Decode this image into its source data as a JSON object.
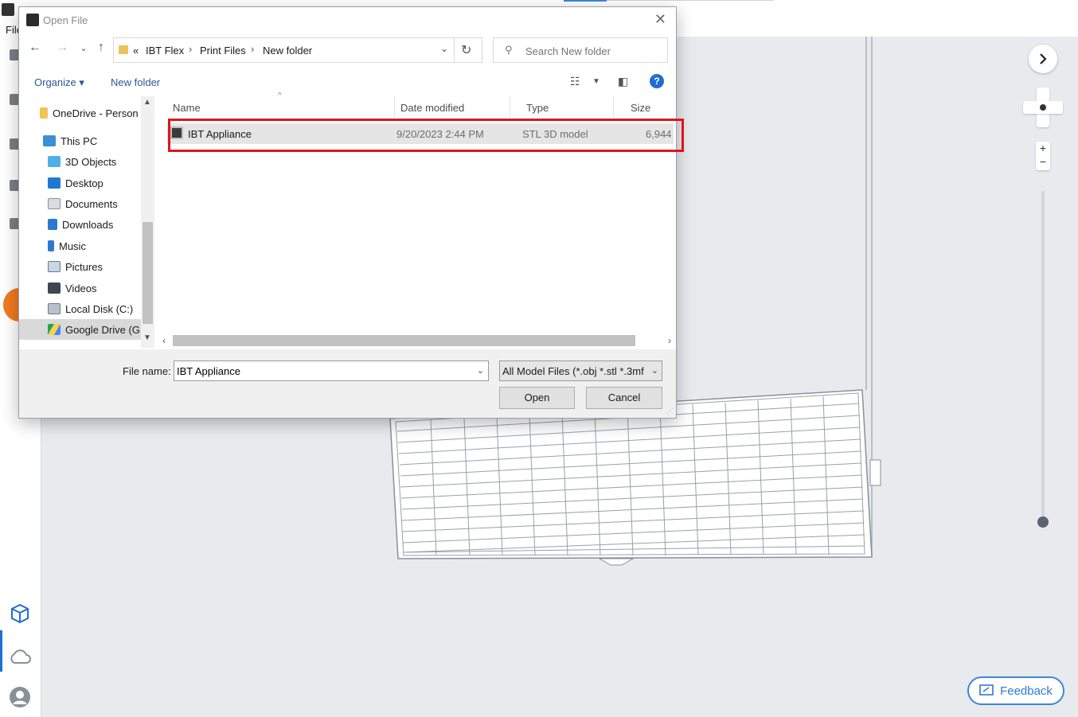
{
  "app": {
    "file_menu": "File",
    "feedback_label": "Feedback"
  },
  "dialog": {
    "title": "Open File",
    "breadcrumb": {
      "overflow": "«",
      "items": [
        "IBT Flex",
        "Print Files",
        "New folder"
      ]
    },
    "search_placeholder": "Search New folder",
    "toolbar": {
      "organize": "Organize ▾",
      "new_folder": "New folder"
    },
    "nav": {
      "items": [
        {
          "label": "OneDrive - Person",
          "icon": "onedrive-folder-icon"
        },
        {
          "label": "This PC",
          "icon": "pc-icon"
        },
        {
          "label": "3D Objects",
          "icon": "3d-objects-icon"
        },
        {
          "label": "Desktop",
          "icon": "desktop-icon"
        },
        {
          "label": "Documents",
          "icon": "documents-icon"
        },
        {
          "label": "Downloads",
          "icon": "downloads-icon"
        },
        {
          "label": "Music",
          "icon": "music-icon"
        },
        {
          "label": "Pictures",
          "icon": "pictures-icon"
        },
        {
          "label": "Videos",
          "icon": "videos-icon"
        },
        {
          "label": "Local Disk (C:)",
          "icon": "disk-icon"
        },
        {
          "label": "Google Drive (G:",
          "icon": "google-drive-icon"
        }
      ],
      "selected": "Google Drive (G:"
    },
    "columns": [
      "Name",
      "Date modified",
      "Type",
      "Size"
    ],
    "files": [
      {
        "name": "IBT Appliance",
        "date": "9/20/2023 2:44 PM",
        "type": "STL 3D model",
        "size": "6,944"
      }
    ],
    "file_name_label": "File name:",
    "file_name_value": "IBT Appliance",
    "filter_value": "All Model Files (*.obj *.stl *.3mf",
    "open_label": "Open",
    "cancel_label": "Cancel"
  },
  "colors": {
    "highlight": "#e0141c",
    "accent": "#1e6fd0",
    "app_accent": "#3b87d8"
  }
}
